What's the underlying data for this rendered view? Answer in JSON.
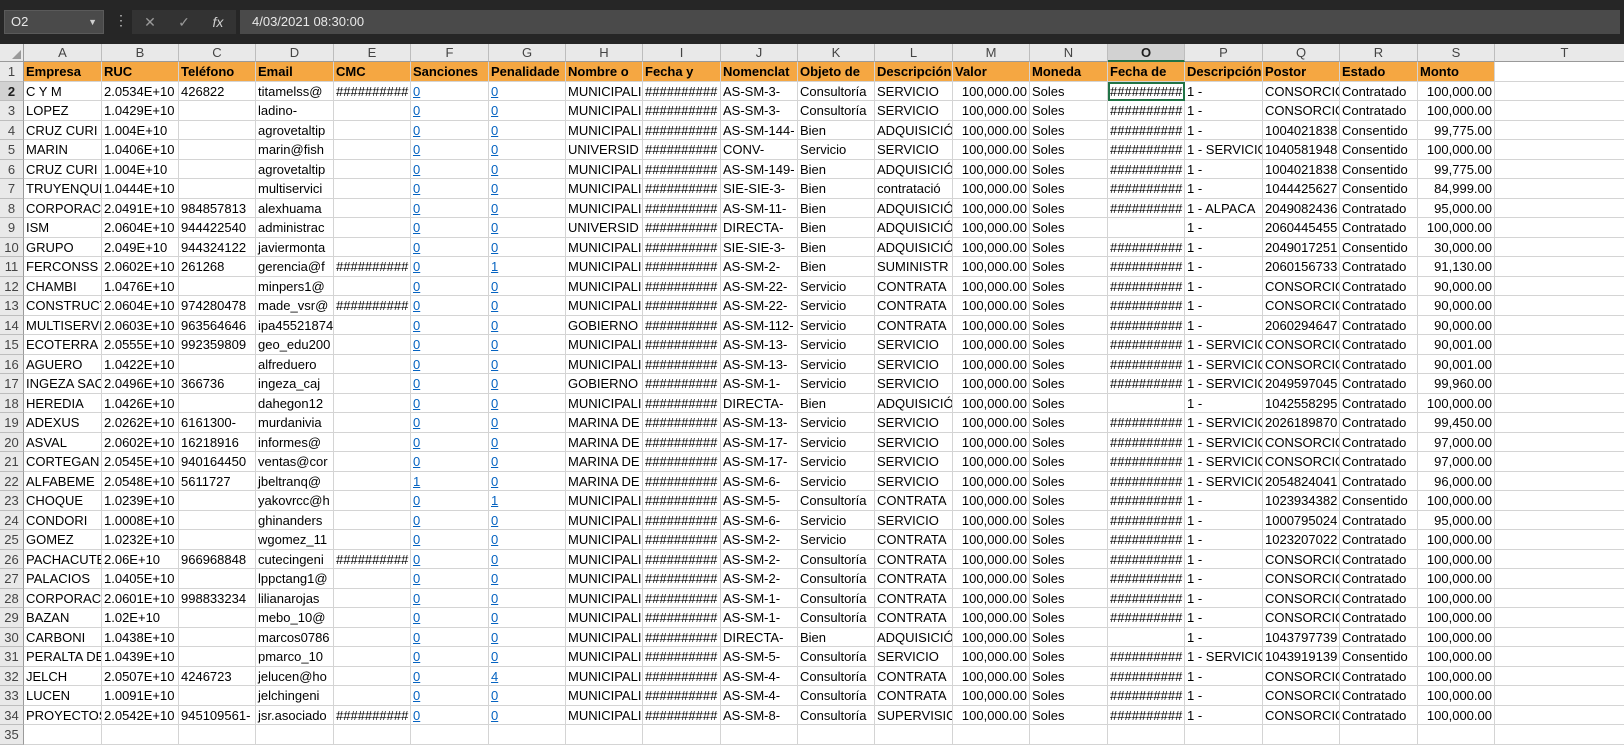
{
  "formula_bar": {
    "name_box": "O2",
    "cancel_label": "✕",
    "enter_label": "✓",
    "fx_label": "fx",
    "value": "4/03/2021  08:30:00"
  },
  "columns": [
    "A",
    "B",
    "C",
    "D",
    "E",
    "F",
    "G",
    "H",
    "I",
    "J",
    "K",
    "L",
    "M",
    "N",
    "O",
    "P",
    "Q",
    "R",
    "S",
    "T"
  ],
  "selected_column": "O",
  "active_cell": {
    "row": 2,
    "col": 14
  },
  "colors": {
    "header_fill": "#f5a742",
    "selection": "#217346",
    "link": "#0563c1"
  },
  "link_columns": [
    5,
    6
  ],
  "rows": [
    {
      "r": "1",
      "c": [
        "Empresa",
        "RUC",
        "Teléfono",
        "Email",
        "CMC",
        "Sanciones",
        "Penalidade",
        "Nombre o",
        "Fecha y",
        "Nomenclat",
        "Objeto de",
        "Descripción",
        "Valor",
        "Moneda",
        "Fecha de",
        "Descripción",
        "Postor",
        "Estado",
        "Monto"
      ]
    },
    {
      "r": "2",
      "c": [
        "C Y M",
        "2.0534E+10",
        "426822",
        "titamelss@",
        "##########",
        "0",
        "0",
        "MUNICIPALI",
        "##########",
        "AS-SM-3-",
        "Consultoría",
        "SERVICIO",
        "100,000.00",
        "Soles",
        "##########",
        "1 -",
        "CONSORCIO",
        "Contratado",
        "100,000.00"
      ]
    },
    {
      "r": "3",
      "c": [
        "LOPEZ",
        "1.0429E+10",
        "",
        "ladino-",
        "",
        "0",
        "0",
        "MUNICIPALI",
        "##########",
        "AS-SM-3-",
        "Consultoría",
        "SERVICIO",
        "100,000.00",
        "Soles",
        "##########",
        "1 -",
        "CONSORCIO",
        "Contratado",
        "100,000.00"
      ]
    },
    {
      "r": "4",
      "c": [
        "CRUZ CURI",
        "1.004E+10",
        "",
        "agrovetaltip",
        "",
        "0",
        "0",
        "MUNICIPALI",
        "##########",
        "AS-SM-144-",
        "Bien",
        "ADQUISICIÓ",
        "100,000.00",
        "Soles",
        "##########",
        "1 -",
        "1004021838",
        "Consentido",
        "99,775.00"
      ]
    },
    {
      "r": "5",
      "c": [
        "MARIN",
        "1.0406E+10",
        "",
        "marin@fish",
        "",
        "0",
        "0",
        "UNIVERSID",
        "##########",
        "CONV-",
        "Servicio",
        "SERVICIO",
        "100,000.00",
        "Soles",
        "##########",
        "1 - SERVICIO",
        "1040581948",
        "Consentido",
        "100,000.00"
      ]
    },
    {
      "r": "6",
      "c": [
        "CRUZ CURI",
        "1.004E+10",
        "",
        "agrovetaltip",
        "",
        "0",
        "0",
        "MUNICIPALI",
        "##########",
        "AS-SM-149-",
        "Bien",
        "ADQUISICIÓ",
        "100,000.00",
        "Soles",
        "##########",
        "1 -",
        "1004021838",
        "Consentido",
        "99,775.00"
      ]
    },
    {
      "r": "7",
      "c": [
        "TRUYENQUE",
        "1.0444E+10",
        "",
        "multiservici",
        "",
        "0",
        "0",
        "MUNICIPALI",
        "##########",
        "SIE-SIE-3-",
        "Bien",
        "contratació",
        "100,000.00",
        "Soles",
        "##########",
        "1 -",
        "1044425627",
        "Consentido",
        "84,999.00"
      ]
    },
    {
      "r": "8",
      "c": [
        "CORPORACI",
        "2.0491E+10",
        "984857813",
        "alexhuama",
        "",
        "0",
        "0",
        "MUNICIPALI",
        "##########",
        "AS-SM-11-",
        "Bien",
        "ADQUISICIÓ",
        "100,000.00",
        "Soles",
        "##########",
        "1 - ALPACA",
        "2049082436",
        "Contratado",
        "95,000.00"
      ]
    },
    {
      "r": "9",
      "c": [
        "ISM",
        "2.0604E+10",
        "944422540",
        "administrac",
        "",
        "0",
        "0",
        "UNIVERSID",
        "##########",
        "DIRECTA-",
        "Bien",
        "ADQUISICIÓ",
        "100,000.00",
        "Soles",
        "",
        "1 -",
        "2060445455",
        "Contratado",
        "100,000.00"
      ]
    },
    {
      "r": "10",
      "c": [
        "GRUPO",
        "2.049E+10",
        "944324122",
        "javiermonta",
        "",
        "0",
        "0",
        "MUNICIPALI",
        "##########",
        "SIE-SIE-3-",
        "Bien",
        "ADQUISICIÓ",
        "100,000.00",
        "Soles",
        "##########",
        "1 -",
        "2049017251",
        "Consentido",
        "30,000.00"
      ]
    },
    {
      "r": "11",
      "c": [
        "FERCONSS",
        "2.0602E+10",
        "261268",
        "gerencia@f",
        "##########",
        "0",
        "1",
        "MUNICIPALI",
        "##########",
        "AS-SM-2-",
        "Bien",
        "SUMINISTR",
        "100,000.00",
        "Soles",
        "##########",
        "1 -",
        "2060156733",
        "Contratado",
        "91,130.00"
      ]
    },
    {
      "r": "12",
      "c": [
        "CHAMBI",
        "1.0476E+10",
        "",
        "minpers1@",
        "",
        "0",
        "0",
        "MUNICIPALI",
        "##########",
        "AS-SM-22-",
        "Servicio",
        "CONTRATA",
        "100,000.00",
        "Soles",
        "##########",
        "1 -",
        "CONSORCIO",
        "Contratado",
        "90,000.00"
      ]
    },
    {
      "r": "13",
      "c": [
        "CONSTRUCT",
        "2.0604E+10",
        "974280478",
        "made_vsr@",
        "##########",
        "0",
        "0",
        "MUNICIPALI",
        "##########",
        "AS-SM-22-",
        "Servicio",
        "CONTRATA",
        "100,000.00",
        "Soles",
        "##########",
        "1 -",
        "CONSORCIO",
        "Contratado",
        "90,000.00"
      ]
    },
    {
      "r": "14",
      "c": [
        "MULTISERVI",
        "2.0603E+10",
        "963564646",
        "ipa45521874",
        "",
        "0",
        "0",
        "GOBIERNO",
        "##########",
        "AS-SM-112-",
        "Servicio",
        "CONTRATA",
        "100,000.00",
        "Soles",
        "##########",
        "1 -",
        "2060294647",
        "Contratado",
        "90,000.00"
      ]
    },
    {
      "r": "15",
      "c": [
        "ECOTERRA",
        "2.0555E+10",
        "992359809",
        "geo_edu200",
        "",
        "0",
        "0",
        "MUNICIPALI",
        "##########",
        "AS-SM-13-",
        "Servicio",
        "SERVICIO",
        "100,000.00",
        "Soles",
        "##########",
        "1 - SERVICIO",
        "CONSORCIO",
        "Contratado",
        "90,001.00"
      ]
    },
    {
      "r": "16",
      "c": [
        "AGUERO",
        "1.0422E+10",
        "",
        "alfreduero",
        "",
        "0",
        "0",
        "MUNICIPALI",
        "##########",
        "AS-SM-13-",
        "Servicio",
        "SERVICIO",
        "100,000.00",
        "Soles",
        "##########",
        "1 - SERVICIO",
        "CONSORCIO",
        "Contratado",
        "90,001.00"
      ]
    },
    {
      "r": "17",
      "c": [
        "INGEZA SAC",
        "2.0496E+10",
        "366736",
        "ingeza_caj",
        "",
        "0",
        "0",
        "GOBIERNO",
        "##########",
        "AS-SM-1-",
        "Servicio",
        "SERVICIO",
        "100,000.00",
        "Soles",
        "##########",
        "1 - SERVICIO",
        "2049597045",
        "Contratado",
        "99,960.00"
      ]
    },
    {
      "r": "18",
      "c": [
        "HEREDIA",
        "1.0426E+10",
        "",
        "dahegon12",
        "",
        "0",
        "0",
        "MUNICIPALI",
        "##########",
        "DIRECTA-",
        "Bien",
        "ADQUISICIÓ",
        "100,000.00",
        "Soles",
        "",
        "1 -",
        "1042558295",
        "Contratado",
        "100,000.00"
      ]
    },
    {
      "r": "19",
      "c": [
        "ADEXUS",
        "2.0262E+10",
        "6161300-",
        "murdanivia",
        "",
        "0",
        "0",
        "MARINA DE",
        "##########",
        "AS-SM-13-",
        "Servicio",
        "SERVICIO",
        "100,000.00",
        "Soles",
        "##########",
        "1 - SERVICIO",
        "2026189870",
        "Contratado",
        "99,450.00"
      ]
    },
    {
      "r": "20",
      "c": [
        "ASVAL",
        "2.0602E+10",
        "16218916",
        "informes@",
        "",
        "0",
        "0",
        "MARINA DE",
        "##########",
        "AS-SM-17-",
        "Servicio",
        "SERVICIO",
        "100,000.00",
        "Soles",
        "##########",
        "1 - SERVICIO",
        "CONSORCIO",
        "Contratado",
        "97,000.00"
      ]
    },
    {
      "r": "21",
      "c": [
        "CORTEGAN",
        "2.0545E+10",
        "940164450",
        "ventas@cor",
        "",
        "0",
        "0",
        "MARINA DE",
        "##########",
        "AS-SM-17-",
        "Servicio",
        "SERVICIO",
        "100,000.00",
        "Soles",
        "##########",
        "1 - SERVICIO",
        "CONSORCIO",
        "Contratado",
        "97,000.00"
      ]
    },
    {
      "r": "22",
      "c": [
        "ALFABEME",
        "2.0548E+10",
        "5611727",
        "jbeltranq@",
        "",
        "1",
        "0",
        "MARINA DE",
        "##########",
        "AS-SM-6-",
        "Servicio",
        "SERVICIO",
        "100,000.00",
        "Soles",
        "##########",
        "1 - SERVICIO",
        "2054824041",
        "Contratado",
        "96,000.00"
      ]
    },
    {
      "r": "23",
      "c": [
        "CHOQUE",
        "1.0239E+10",
        "",
        "yakovrcc@h",
        "",
        "0",
        "1",
        "MUNICIPALI",
        "##########",
        "AS-SM-5-",
        "Consultoría",
        "CONTRATA",
        "100,000.00",
        "Soles",
        "##########",
        "1 -",
        "1023934382",
        "Consentido",
        "100,000.00"
      ]
    },
    {
      "r": "24",
      "c": [
        "CONDORI",
        "1.0008E+10",
        "",
        "ghinanders",
        "",
        "0",
        "0",
        "MUNICIPALI",
        "##########",
        "AS-SM-6-",
        "Servicio",
        "SERVICIO",
        "100,000.00",
        "Soles",
        "##########",
        "1 -",
        "1000795024",
        "Contratado",
        "95,000.00"
      ]
    },
    {
      "r": "25",
      "c": [
        "GOMEZ",
        "1.0232E+10",
        "",
        "wgomez_11",
        "",
        "0",
        "0",
        "MUNICIPALI",
        "##########",
        "AS-SM-2-",
        "Servicio",
        "CONTRATA",
        "100,000.00",
        "Soles",
        "##########",
        "1 -",
        "1023207022",
        "Contratado",
        "100,000.00"
      ]
    },
    {
      "r": "26",
      "c": [
        "PACHACUTE",
        "2.06E+10",
        "966968848",
        "cutecingeni",
        "##########",
        "0",
        "0",
        "MUNICIPALI",
        "##########",
        "AS-SM-2-",
        "Consultoría",
        "CONTRATA",
        "100,000.00",
        "Soles",
        "##########",
        "1 -",
        "CONSORCIO",
        "Contratado",
        "100,000.00"
      ]
    },
    {
      "r": "27",
      "c": [
        "PALACIOS",
        "1.0405E+10",
        "",
        "lppctang1@",
        "",
        "0",
        "0",
        "MUNICIPALI",
        "##########",
        "AS-SM-2-",
        "Consultoría",
        "CONTRATA",
        "100,000.00",
        "Soles",
        "##########",
        "1 -",
        "CONSORCIO",
        "Contratado",
        "100,000.00"
      ]
    },
    {
      "r": "28",
      "c": [
        "CORPORACI",
        "2.0601E+10",
        "998833234",
        "lilianarojas",
        "",
        "0",
        "0",
        "MUNICIPALI",
        "##########",
        "AS-SM-1-",
        "Consultoría",
        "CONTRATA",
        "100,000.00",
        "Soles",
        "##########",
        "1 -",
        "CONSORCIO",
        "Contratado",
        "100,000.00"
      ]
    },
    {
      "r": "29",
      "c": [
        "BAZAN",
        "1.02E+10",
        "",
        "mebo_10@",
        "",
        "0",
        "0",
        "MUNICIPALI",
        "##########",
        "AS-SM-1-",
        "Consultoría",
        "CONTRATA",
        "100,000.00",
        "Soles",
        "##########",
        "1 -",
        "CONSORCIO",
        "Contratado",
        "100,000.00"
      ]
    },
    {
      "r": "30",
      "c": [
        "CARBONI",
        "1.0438E+10",
        "",
        "marcos0786",
        "",
        "0",
        "0",
        "MUNICIPALI",
        "##########",
        "DIRECTA-",
        "Bien",
        "ADQUISICIÓ",
        "100,000.00",
        "Soles",
        "",
        "1 -",
        "1043797739",
        "Contratado",
        "100,000.00"
      ]
    },
    {
      "r": "31",
      "c": [
        "PERALTA DE",
        "1.0439E+10",
        "",
        "pmarco_10",
        "",
        "0",
        "0",
        "MUNICIPALI",
        "##########",
        "AS-SM-5-",
        "Consultoría",
        "SERVICIO",
        "100,000.00",
        "Soles",
        "##########",
        "1 - SERVICIO",
        "1043919139",
        "Consentido",
        "100,000.00"
      ]
    },
    {
      "r": "32",
      "c": [
        "JELCH",
        "2.0507E+10",
        "4246723",
        "jelucen@ho",
        "",
        "0",
        "4",
        "MUNICIPALI",
        "##########",
        "AS-SM-4-",
        "Consultoría",
        "CONTRATA",
        "100,000.00",
        "Soles",
        "##########",
        "1 -",
        "CONSORCIO",
        "Contratado",
        "100,000.00"
      ]
    },
    {
      "r": "33",
      "c": [
        "LUCEN",
        "1.0091E+10",
        "",
        "jelchingeni",
        "",
        "0",
        "0",
        "MUNICIPALI",
        "##########",
        "AS-SM-4-",
        "Consultoría",
        "CONTRATA",
        "100,000.00",
        "Soles",
        "##########",
        "1 -",
        "CONSORCIO",
        "Contratado",
        "100,000.00"
      ]
    },
    {
      "r": "34",
      "c": [
        "PROYECTOS",
        "2.0542E+10",
        "945109561-",
        "jsr.asociado",
        "##########",
        "0",
        "0",
        "MUNICIPALI",
        "##########",
        "AS-SM-8-",
        "Consultoría",
        "SUPERVISIO",
        "100,000.00",
        "Soles",
        "##########",
        "1 -",
        "CONSORCIO",
        "Contratado",
        "100,000.00"
      ]
    },
    {
      "r": "35",
      "c": [
        "",
        "",
        "",
        "",
        "",
        "",
        "",
        "",
        "",
        "",
        "",
        "",
        "",
        "",
        "",
        "",
        "",
        "",
        ""
      ]
    }
  ]
}
